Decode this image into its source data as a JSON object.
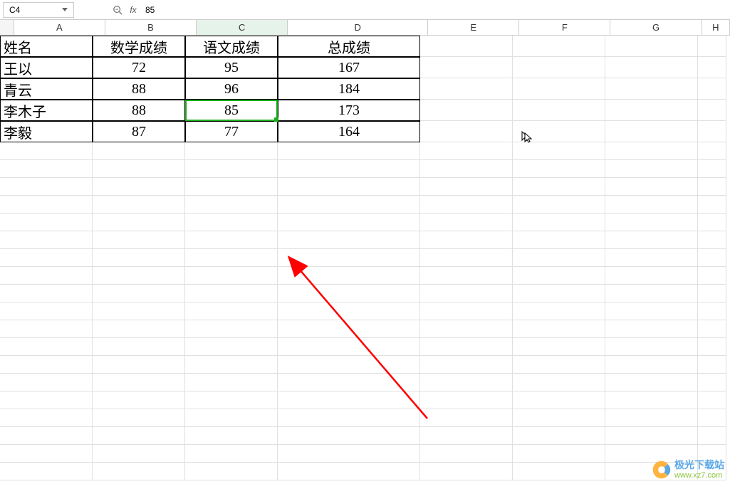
{
  "formula_bar": {
    "cell_ref": "C4",
    "fx_label": "fx",
    "formula_value": "85"
  },
  "columns": [
    "A",
    "B",
    "C",
    "D",
    "E",
    "F",
    "G",
    "H"
  ],
  "selected_column": "C",
  "selected_cell": "C4",
  "table": {
    "headers": [
      "姓名",
      "数学成绩",
      "语文成绩",
      "总成绩"
    ],
    "rows": [
      {
        "name": "王以",
        "math": "72",
        "chinese": "95",
        "total": "167"
      },
      {
        "name": "青云",
        "math": "88",
        "chinese": "96",
        "total": "184"
      },
      {
        "name": "李木子",
        "math": "88",
        "chinese": "85",
        "total": "173"
      },
      {
        "name": "李毅",
        "math": "87",
        "chinese": "77",
        "total": "164"
      }
    ]
  },
  "watermark": {
    "title": "极光下载站",
    "url": "www.xz7.com"
  }
}
